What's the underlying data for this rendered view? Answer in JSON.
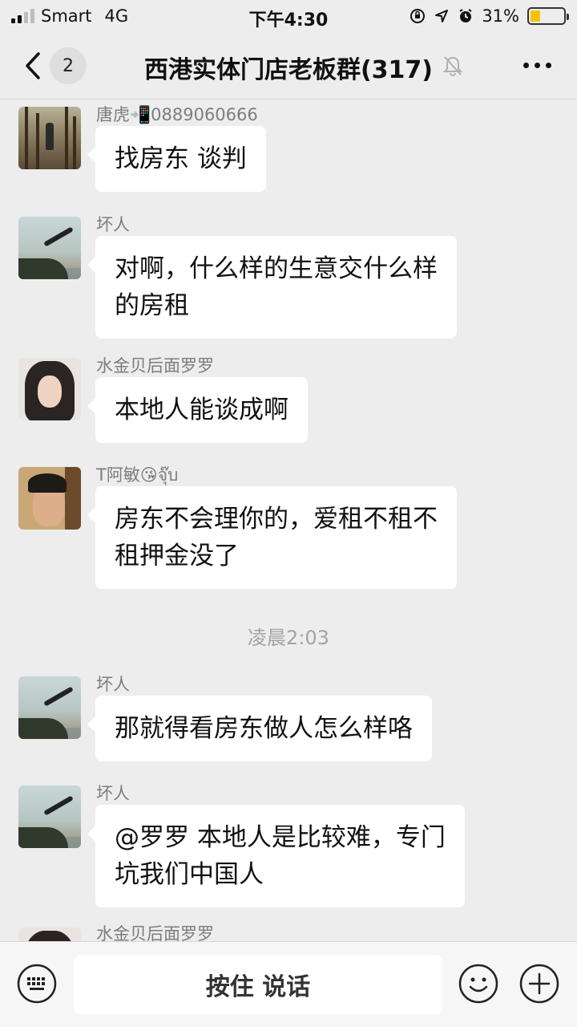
{
  "status_bar": {
    "carrier": "Smart",
    "network": "4G",
    "time": "下午4:30",
    "battery": "31%",
    "battery_level": 0.31
  },
  "nav": {
    "back_count": "2",
    "title": "西港实体门店老板群(317)"
  },
  "messages": [
    {
      "sender": "唐虎📲0889060666",
      "lines": [
        "找房东 谈判"
      ]
    },
    {
      "sender": "坏人",
      "lines": [
        "对啊，什么样的生意交什么样",
        "的房租"
      ]
    },
    {
      "sender": "水金贝后面罗罗",
      "lines": [
        "本地人能谈成啊"
      ]
    },
    {
      "sender": "T阿敏😘จุ๊บ",
      "lines": [
        "房东不会理你的，爱租不租不",
        "租押金没了"
      ]
    },
    {
      "sender": "坏人",
      "lines": [
        "那就得看房东做人怎么样咯"
      ]
    },
    {
      "sender": "坏人",
      "lines": [
        "@罗罗 本地人是比较难，专门",
        "坑我们中国人"
      ]
    },
    {
      "sender": "水金贝后面罗罗",
      "lines": []
    }
  ],
  "timestamp": "凌晨2:03",
  "input_bar": {
    "hold_to_talk": "按住 说话"
  }
}
